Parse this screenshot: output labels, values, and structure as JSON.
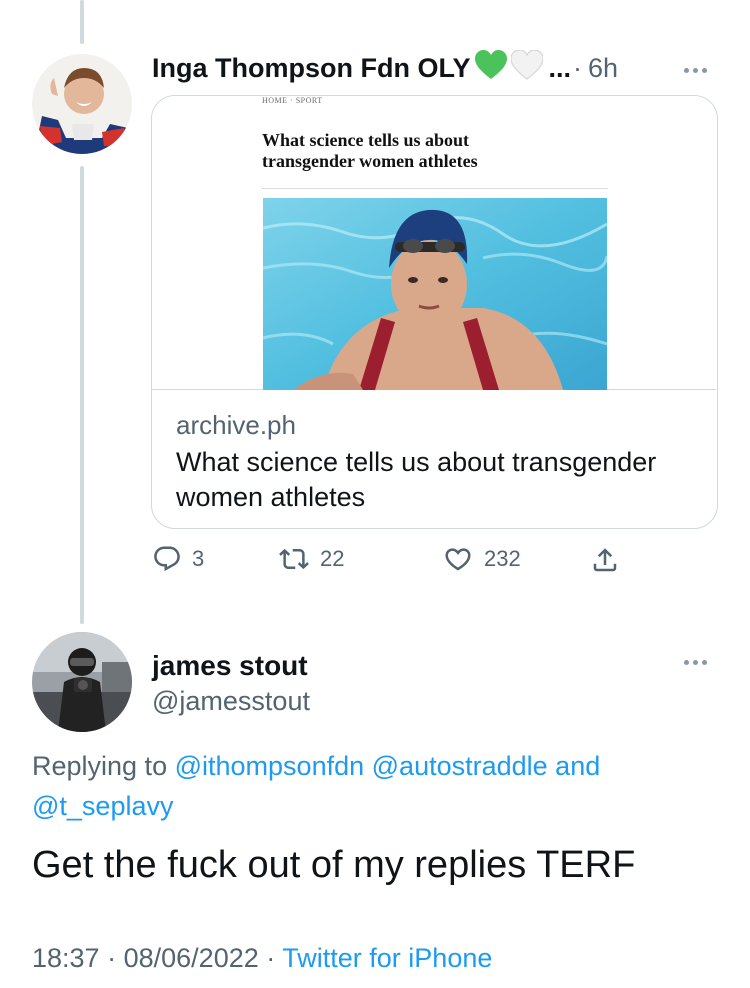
{
  "tweet1": {
    "display_name": "Inga Thompson Fdn OLY",
    "name_emojis": [
      "green-heart-icon",
      "white-heart-icon"
    ],
    "ellipsis": "...",
    "separator": "·",
    "time": "6h",
    "card": {
      "article": {
        "breadcrumb": "HOME · SPORT",
        "headline": "What science tells us about transgender women athletes"
      },
      "domain": "archive.ph",
      "title": "What science tells us about transgender women athletes"
    },
    "counts": {
      "replies": "3",
      "retweets": "22",
      "likes": "232"
    }
  },
  "tweet2": {
    "display_name": "james stout",
    "handle": "@jamesstout",
    "replying_prefix": "Replying to",
    "mentions": [
      "@ithompsonfdn",
      "@autostraddle",
      "@t_seplavy"
    ],
    "replying_and": "and",
    "text": "Get the fuck out of my replies TERF",
    "time": "18:37",
    "date": "08/06/2022",
    "source": "Twitter for iPhone",
    "separator": "·"
  },
  "colors": {
    "text_primary": "#0f1419",
    "text_secondary": "#536471",
    "link": "#1d9bf0",
    "border": "#cfd9de",
    "heart_green": "#4cc35a"
  }
}
